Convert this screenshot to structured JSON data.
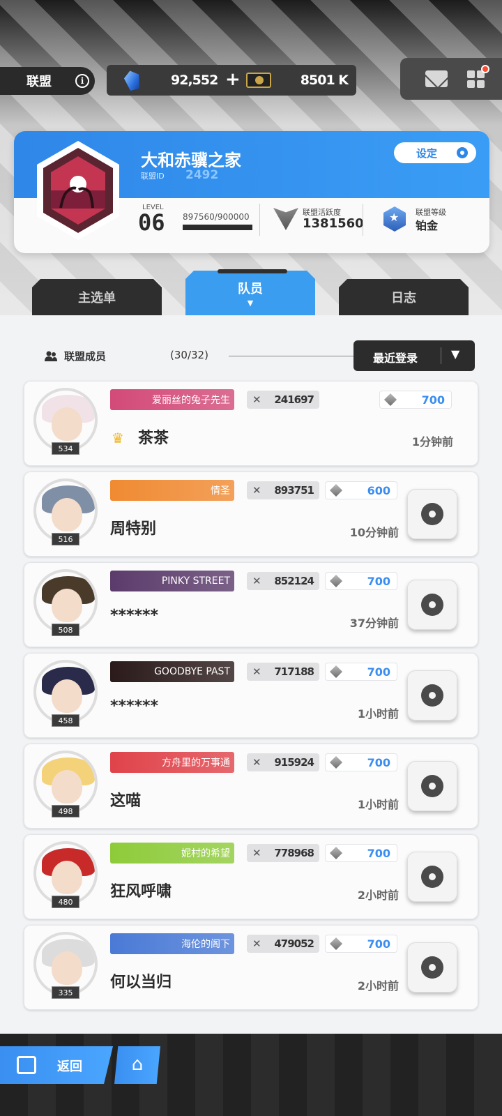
{
  "header": {
    "title": "联盟",
    "gems": "92,552",
    "credits": "8501 K"
  },
  "guild": {
    "name": "大和赤骥之家",
    "id_label": "联盟ID",
    "id": "2492",
    "settings_label": "设定",
    "level_label": "LEVEL",
    "level": "06",
    "xp": "897560/900000",
    "xp_fraction": 0.997,
    "activity_label": "联盟活跃度",
    "activity": "1381560",
    "rank_label": "联盟等级",
    "rank": "铂金"
  },
  "tabs": [
    "主选单",
    "队员",
    "日志"
  ],
  "tab_caret": "▼",
  "members_section": {
    "label": "联盟成员",
    "count": "(30/32)",
    "sort_label": "最近登录",
    "sort_arrow": "▼"
  },
  "members": [
    {
      "nameplate": "爱丽丝的兔子先生",
      "power": "241697",
      "contribution": "700",
      "name": "茶茶",
      "last_login": "1分钟前",
      "level": "534",
      "is_leader": true,
      "plate_color": "#d34a78",
      "hair": "#f0e2e6"
    },
    {
      "nameplate": "情圣",
      "power": "893751",
      "contribution": "600",
      "name": "周特别",
      "last_login": "10分钟前",
      "level": "516",
      "is_leader": false,
      "plate_color": "#f08a32",
      "hair": "#7f8fa6"
    },
    {
      "nameplate": "PINKY STREET",
      "power": "852124",
      "contribution": "700",
      "name": "******",
      "last_login": "37分钟前",
      "level": "508",
      "is_leader": false,
      "plate_color": "#5b3b6b",
      "hair": "#4a3a2a"
    },
    {
      "nameplate": "GOODBYE PAST",
      "power": "717188",
      "contribution": "700",
      "name": "******",
      "last_login": "1小时前",
      "level": "458",
      "is_leader": false,
      "plate_color": "#2a1a1a",
      "hair": "#2a2a4a"
    },
    {
      "nameplate": "方舟里的万事通",
      "power": "915924",
      "contribution": "700",
      "name": "这喵",
      "last_login": "1小时前",
      "level": "498",
      "is_leader": false,
      "plate_color": "#e0434a",
      "hair": "#f3d27a"
    },
    {
      "nameplate": "妮村的希望",
      "power": "778968",
      "contribution": "700",
      "name": "狂风呼啸",
      "last_login": "2小时前",
      "level": "480",
      "is_leader": false,
      "plate_color": "#8ecb3a",
      "hair": "#c82a2a"
    },
    {
      "nameplate": "海伦的阁下",
      "power": "479052",
      "contribution": "700",
      "name": "何以当归",
      "last_login": "2小时前",
      "level": "335",
      "is_leader": false,
      "plate_color": "#4a7ad6",
      "hair": "#dcdcdc"
    }
  ],
  "footer": {
    "back_label": "返回",
    "home_icon": "home-icon"
  }
}
